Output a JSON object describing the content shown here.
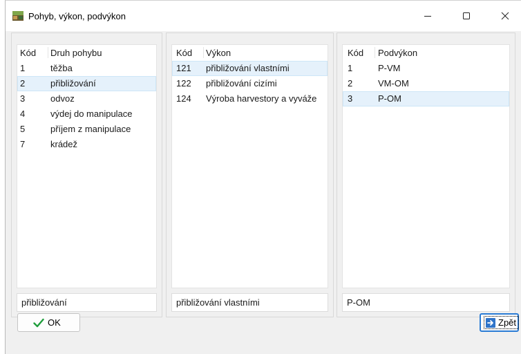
{
  "window": {
    "title": "Pohyb, výkon, podvýkon"
  },
  "movement": {
    "headers": [
      "Kód",
      "Druh pohybu"
    ],
    "rows": [
      {
        "code": "1",
        "name": "těžba"
      },
      {
        "code": "2",
        "name": "přibližování"
      },
      {
        "code": "3",
        "name": "odvoz"
      },
      {
        "code": "4",
        "name": "výdej do manipulace"
      },
      {
        "code": "5",
        "name": "příjem z manipulace"
      },
      {
        "code": "7",
        "name": "krádež"
      }
    ],
    "selected_index": 1,
    "selected_value": "přibližování"
  },
  "performance": {
    "headers": [
      "Kód",
      "Výkon"
    ],
    "rows": [
      {
        "code": "121",
        "name": "přibližování vlastními"
      },
      {
        "code": "122",
        "name": "přibližování cizími"
      },
      {
        "code": "124",
        "name": "Výroba harvestory a vyváže"
      }
    ],
    "selected_index": 0,
    "selected_value": "přibližování vlastními"
  },
  "subperformance": {
    "headers": [
      "Kód",
      "Podvýkon"
    ],
    "rows": [
      {
        "code": "1",
        "name": "P-VM"
      },
      {
        "code": "2",
        "name": "VM-OM"
      },
      {
        "code": "3",
        "name": "P-OM"
      }
    ],
    "selected_index": 2,
    "selected_value": "P-OM"
  },
  "buttons": {
    "ok_label": "OK",
    "back_label": "Zpět"
  },
  "icons": {
    "app": "app-icon",
    "ok": "checkmark-icon",
    "back": "exit-arrow-icon"
  },
  "colors": {
    "selection": "#e5f1fb",
    "ok_check": "#1f9e3c",
    "focus_border": "#2a7bd4",
    "back_icon": "#2f74c9"
  }
}
